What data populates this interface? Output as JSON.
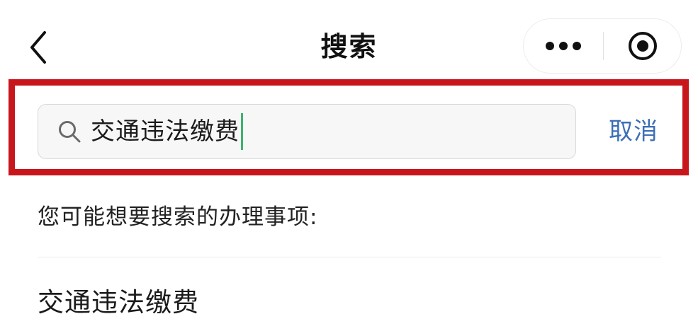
{
  "header": {
    "title": "搜索",
    "back_icon": "chevron-left-icon",
    "more_icon": "more-dots-icon",
    "close_icon": "target-close-icon"
  },
  "search": {
    "query": "交通违法缴费",
    "cursor_color": "#3cb46e",
    "cancel_label": "取消",
    "highlight_color": "#c8161d"
  },
  "suggestions": {
    "heading": "您可能想要搜索的办理事项:",
    "items": [
      {
        "label": "交通违法缴费"
      }
    ]
  },
  "colors": {
    "accent_link": "#3d6fb6",
    "text": "#1a1a1a",
    "background": "#ffffff"
  }
}
